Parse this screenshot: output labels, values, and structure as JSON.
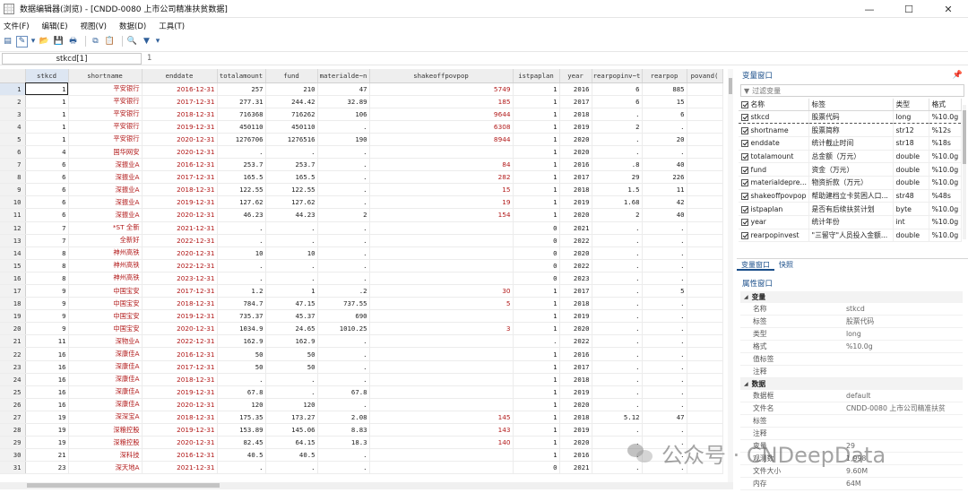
{
  "window": {
    "title": "数据编辑器(浏览) - [CNDD-0080 上市公司精准扶贫数据]",
    "minimize": "—",
    "maximize": "☐",
    "close": "✕"
  },
  "menu": [
    "文件(F)",
    "编辑(E)",
    "视图(V)",
    "数据(D)",
    "工具(T)"
  ],
  "cellbar": {
    "name": "stkcd[1]",
    "value": "1"
  },
  "grid": {
    "columns": [
      "stkcd",
      "shortname",
      "enddate",
      "totalamount",
      "fund",
      "materialde~n",
      "shakeoffpovpop",
      "istpaplan",
      "year",
      "rearpopinv~t",
      "rearpop",
      "povand("
    ],
    "rows": [
      [
        "1",
        "1",
        "平安银行",
        "2016-12-31",
        "257",
        "210",
        "47",
        "5749",
        "1",
        "2016",
        "6",
        "885",
        ""
      ],
      [
        "2",
        "1",
        "平安银行",
        "2017-12-31",
        "277.31",
        "244.42",
        "32.89",
        "185",
        "1",
        "2017",
        "6",
        "15",
        ""
      ],
      [
        "3",
        "1",
        "平安银行",
        "2018-12-31",
        "716368",
        "716262",
        "106",
        "9644",
        "1",
        "2018",
        ".",
        "6",
        ""
      ],
      [
        "4",
        "1",
        "平安银行",
        "2019-12-31",
        "450110",
        "450110",
        ".",
        "6308",
        "1",
        "2019",
        "2",
        ".",
        ""
      ],
      [
        "5",
        "1",
        "平安银行",
        "2020-12-31",
        "1276706",
        "1276516",
        "190",
        "8944",
        "1",
        "2020",
        ".",
        "20",
        ""
      ],
      [
        "6",
        "4",
        "国华网安",
        "2020-12-31",
        ".",
        ".",
        ".",
        "",
        "1",
        "2020",
        ".",
        ".",
        ""
      ],
      [
        "7",
        "6",
        "深振业A",
        "2016-12-31",
        "253.7",
        "253.7",
        ".",
        "84",
        "1",
        "2016",
        ".8",
        "40",
        ""
      ],
      [
        "8",
        "6",
        "深振业A",
        "2017-12-31",
        "165.5",
        "165.5",
        ".",
        "282",
        "1",
        "2017",
        "29",
        "226",
        ""
      ],
      [
        "9",
        "6",
        "深振业A",
        "2018-12-31",
        "122.55",
        "122.55",
        ".",
        "15",
        "1",
        "2018",
        "1.5",
        "11",
        ""
      ],
      [
        "10",
        "6",
        "深振业A",
        "2019-12-31",
        "127.62",
        "127.62",
        ".",
        "19",
        "1",
        "2019",
        "1.68",
        "42",
        ""
      ],
      [
        "11",
        "6",
        "深振业A",
        "2020-12-31",
        "46.23",
        "44.23",
        "2",
        "154",
        "1",
        "2020",
        "2",
        "40",
        ""
      ],
      [
        "12",
        "7",
        "*ST 全新",
        "2021-12-31",
        ".",
        ".",
        ".",
        "",
        "0",
        "2021",
        ".",
        ".",
        ""
      ],
      [
        "13",
        "7",
        "全新好",
        "2022-12-31",
        ".",
        ".",
        ".",
        "",
        "0",
        "2022",
        ".",
        ".",
        ""
      ],
      [
        "14",
        "8",
        "神州高铁",
        "2020-12-31",
        "10",
        "10",
        ".",
        "",
        "0",
        "2020",
        ".",
        ".",
        ""
      ],
      [
        "15",
        "8",
        "神州高铁",
        "2022-12-31",
        ".",
        ".",
        ".",
        "",
        "0",
        "2022",
        ".",
        ".",
        ""
      ],
      [
        "16",
        "8",
        "神州高铁",
        "2023-12-31",
        ".",
        ".",
        ".",
        "",
        "0",
        "2023",
        ".",
        ".",
        ""
      ],
      [
        "17",
        "9",
        "中国宝安",
        "2017-12-31",
        "1.2",
        "1",
        ".2",
        "30",
        "1",
        "2017",
        ".",
        "5",
        ""
      ],
      [
        "18",
        "9",
        "中国宝安",
        "2018-12-31",
        "784.7",
        "47.15",
        "737.55",
        "5",
        "1",
        "2018",
        ".",
        ".",
        ""
      ],
      [
        "19",
        "9",
        "中国宝安",
        "2019-12-31",
        "735.37",
        "45.37",
        "690",
        "",
        "1",
        "2019",
        ".",
        ".",
        ""
      ],
      [
        "20",
        "9",
        "中国宝安",
        "2020-12-31",
        "1034.9",
        "24.65",
        "1010.25",
        "3",
        "1",
        "2020",
        ".",
        ".",
        ""
      ],
      [
        "21",
        "11",
        "深物业A",
        "2022-12-31",
        "162.9",
        "162.9",
        ".",
        "",
        ".",
        "2022",
        ".",
        ".",
        ""
      ],
      [
        "22",
        "16",
        "深康佳A",
        "2016-12-31",
        "50",
        "50",
        ".",
        "",
        "1",
        "2016",
        ".",
        ".",
        ""
      ],
      [
        "23",
        "16",
        "深康佳A",
        "2017-12-31",
        "50",
        "50",
        ".",
        "",
        "1",
        "2017",
        ".",
        ".",
        ""
      ],
      [
        "24",
        "16",
        "深康佳A",
        "2018-12-31",
        ".",
        ".",
        ".",
        "",
        "1",
        "2018",
        ".",
        ".",
        ""
      ],
      [
        "25",
        "16",
        "深康佳A",
        "2019-12-31",
        "67.8",
        ".",
        "67.8",
        "",
        "1",
        "2019",
        ".",
        ".",
        ""
      ],
      [
        "26",
        "16",
        "深康佳A",
        "2020-12-31",
        "120",
        "120",
        ".",
        "",
        "1",
        "2020",
        ".",
        ".",
        ""
      ],
      [
        "27",
        "19",
        "深深宝A",
        "2018-12-31",
        "175.35",
        "173.27",
        "2.08",
        "145",
        "1",
        "2018",
        "5.12",
        "47",
        ""
      ],
      [
        "28",
        "19",
        "深粮控股",
        "2019-12-31",
        "153.89",
        "145.06",
        "8.83",
        "143",
        "1",
        "2019",
        ".",
        ".",
        ""
      ],
      [
        "29",
        "19",
        "深粮控股",
        "2020-12-31",
        "82.45",
        "64.15",
        "18.3",
        "140",
        "1",
        "2020",
        ".",
        ".",
        ""
      ],
      [
        "30",
        "21",
        "深科技",
        "2016-12-31",
        "40.5",
        "40.5",
        ".",
        "",
        "1",
        "2016",
        ".",
        ".",
        ""
      ],
      [
        "31",
        "23",
        "深天地A",
        "2021-12-31",
        ".",
        ".",
        ".",
        "",
        "0",
        "2021",
        ".",
        ".",
        ""
      ]
    ]
  },
  "varpanel": {
    "title": "变量窗口",
    "pin": "📌",
    "filter_placeholder": "过滤变量",
    "headers": [
      "名称",
      "标签",
      "类型",
      "格式"
    ],
    "vars": [
      [
        "stkcd",
        "股票代码",
        "long",
        "%10.0g"
      ],
      [
        "shortname",
        "股票简称",
        "str12",
        "%12s"
      ],
      [
        "enddate",
        "统计截止时间",
        "str18",
        "%18s"
      ],
      [
        "totalamount",
        "总金额（万元）",
        "double",
        "%10.0g"
      ],
      [
        "fund",
        "资金（万元）",
        "double",
        "%10.0g"
      ],
      [
        "materialdepre...",
        "物资折款（万元）",
        "double",
        "%10.0g"
      ],
      [
        "shakeoffpovpop",
        "帮助建档立卡贫困人口...",
        "str48",
        "%48s"
      ],
      [
        "istpaplan",
        "是否有后续扶贫计划",
        "byte",
        "%10.0g"
      ],
      [
        "year",
        "统计年份",
        "int",
        "%10.0g"
      ],
      [
        "rearpopinvest",
        "\"三留守\"人员投入金额...",
        "double",
        "%10.0g"
      ]
    ],
    "tabs": [
      "变量窗口",
      "快照"
    ]
  },
  "propwin": {
    "title": "属性窗口",
    "group1": "变量",
    "var_props": [
      [
        "名称",
        "stkcd"
      ],
      [
        "标签",
        "股票代码"
      ],
      [
        "类型",
        "long"
      ],
      [
        "格式",
        "%10.0g"
      ],
      [
        "值标签",
        ""
      ],
      [
        "注释",
        ""
      ]
    ],
    "group2": "数据",
    "data_props": [
      [
        "数据框",
        "default"
      ],
      [
        "文件名",
        "CNDD-0080 上市公司精准扶贫"
      ],
      [
        "标签",
        ""
      ],
      [
        "注释",
        ""
      ],
      [
        "变量",
        "29"
      ],
      [
        "观测数",
        "1,998"
      ],
      [
        "文件大小",
        "9.60M"
      ],
      [
        "内存",
        "64M"
      ]
    ]
  },
  "watermark": "公众号 · CNDeepData"
}
